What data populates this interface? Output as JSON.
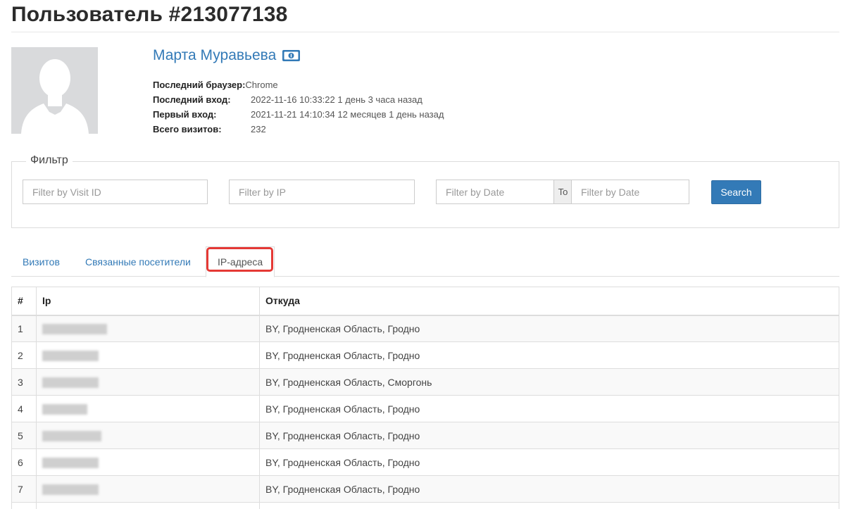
{
  "page": {
    "title": "Пользователь #213077138"
  },
  "user": {
    "name": "Марта Муравьева",
    "badge_icon": "money-icon",
    "info": [
      {
        "label": "Последний браузер:",
        "value": "Chrome"
      },
      {
        "label": "Последний вход:",
        "value": "2022-11-16 10:33:22 1 день 3 часа назад"
      },
      {
        "label": "Первый вход:",
        "value": "2021-11-21 14:10:34 12 месяцев 1 день назад"
      },
      {
        "label": "Всего визитов:",
        "value": "232"
      }
    ]
  },
  "filter": {
    "legend": "Фильтр",
    "visit_id_placeholder": "Filter by Visit ID",
    "ip_placeholder": "Filter by IP",
    "date_from_placeholder": "Filter by Date",
    "to_label": "To",
    "date_to_placeholder": "Filter by Date",
    "search_label": "Search"
  },
  "tabs": [
    {
      "label": "Визитов",
      "active": false
    },
    {
      "label": "Связанные посетители",
      "active": false
    },
    {
      "label": "IP-адреса",
      "active": true
    }
  ],
  "table": {
    "columns": [
      "#",
      "Ip",
      "Откуда"
    ],
    "rows": [
      {
        "num": "1",
        "ip": "",
        "location": "BY, Гродненская Область, Гродно"
      },
      {
        "num": "2",
        "ip": "",
        "location": "BY, Гродненская Область, Гродно"
      },
      {
        "num": "3",
        "ip": "",
        "location": "BY, Гродненская Область, Сморгонь"
      },
      {
        "num": "4",
        "ip": "",
        "location": "BY, Гродненская Область, Гродно"
      },
      {
        "num": "5",
        "ip": "",
        "location": "BY, Гродненская Область, Гродно"
      },
      {
        "num": "6",
        "ip": "",
        "location": "BY, Гродненская Область, Гродно"
      },
      {
        "num": "7",
        "ip": "",
        "location": "BY, Гродненская Область, Гродно"
      }
    ]
  },
  "colors": {
    "link": "#337ab7",
    "highlight": "#e53935",
    "search_button": "#337ab7"
  }
}
